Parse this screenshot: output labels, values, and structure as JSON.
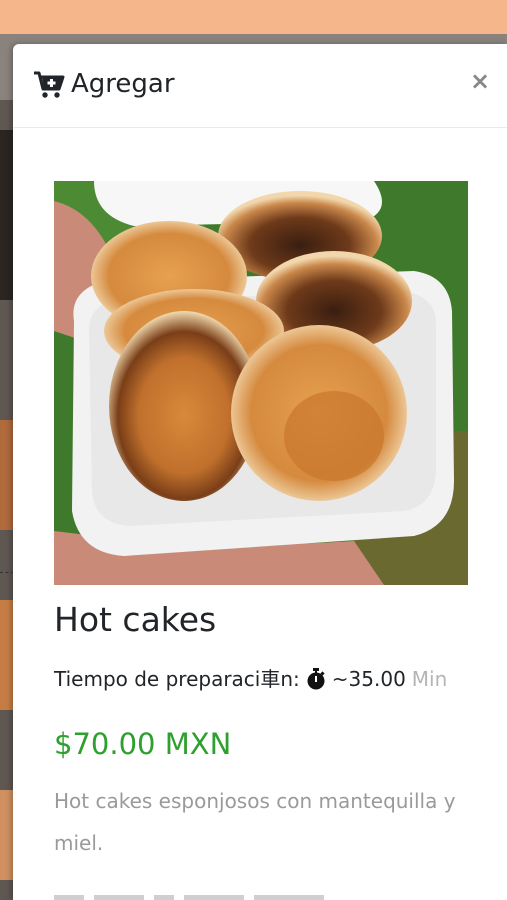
{
  "modal": {
    "title": "Agregar",
    "close_symbol": "×",
    "header_icon": "cart-plus-icon",
    "close_icon": "close-icon"
  },
  "product": {
    "image_alt": "Hot cakes",
    "name": "Hot cakes",
    "prep_label": "Tiempo de preparaci車n:",
    "prep_icon": "stopwatch-icon",
    "prep_value": "~35.00",
    "prep_unit": "Min",
    "price": "$70.00 MXN",
    "description": "Hot cakes esponjosos con mantequilla y miel."
  },
  "colors": {
    "price": "#2ea02e",
    "top_bar": "#f4b68a",
    "muted_text": "#9a9a9a"
  }
}
